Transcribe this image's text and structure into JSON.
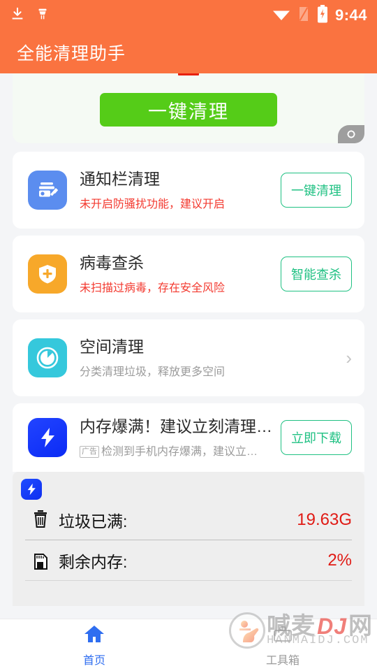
{
  "statusbar": {
    "time": "9:44",
    "icons_left": [
      "download-icon",
      "cleaner-icon"
    ],
    "icons_right": [
      "wifi-icon",
      "sim-icon",
      "battery-charging-icon"
    ],
    "background_color": "#fa7340"
  },
  "appbar": {
    "title": "全能清理助手",
    "background_color": "#fa7340"
  },
  "hero": {
    "button_label": "一键清理",
    "button_color": "#55cc18",
    "ad_corner_icon": "ad-marker-icon"
  },
  "features": [
    {
      "icon": "notification-clean-icon",
      "icon_color": "#5b8def",
      "title": "通知栏清理",
      "subtitle": "未开启防骚扰功能，建议开启",
      "subtitle_style": "warn",
      "action_label": "一键清理",
      "action_type": "button"
    },
    {
      "icon": "shield-virus-icon",
      "icon_color": "#f7a82a",
      "title": "病毒查杀",
      "subtitle": "未扫描过病毒，存在安全风险",
      "subtitle_style": "warn",
      "action_label": "智能查杀",
      "action_type": "button"
    },
    {
      "icon": "pie-storage-icon",
      "icon_color": "#35c8dc",
      "title": "空间清理",
      "subtitle": "分类清理垃圾，释放更多空间",
      "subtitle_style": "muted",
      "action_label": "›",
      "action_type": "chevron"
    },
    {
      "icon": "lightning-icon",
      "icon_color": "#1a3fff",
      "title": "内存爆满！建议立刻清理…",
      "ad_tag": "广告",
      "subtitle": "检测到手机内存爆满，建议立…",
      "subtitle_style": "muted",
      "action_label": "立即下载",
      "action_type": "button"
    }
  ],
  "ad_panel": {
    "badge_icon": "lightning-icon",
    "stats": [
      {
        "icon": "trash-icon",
        "label": "垃圾已满:",
        "value": "19.63G",
        "value_color": "#e01b15"
      },
      {
        "icon": "memory-card-icon",
        "label": "剩余内存:",
        "value": "2%",
        "value_color": "#e01b15"
      }
    ]
  },
  "bottom_nav": {
    "items": [
      {
        "icon": "home-icon",
        "label": "首页",
        "active": true
      },
      {
        "icon": "toolbox-icon",
        "label": "工具箱",
        "active": false
      }
    ],
    "active_color": "#2f6ef0",
    "inactive_color": "#9b9b9b"
  },
  "watermark": {
    "text_cn_1": "喊麦",
    "text_dj": "DJ",
    "text_cn_2": "网",
    "domain": "HANMAIDJ.COM"
  }
}
